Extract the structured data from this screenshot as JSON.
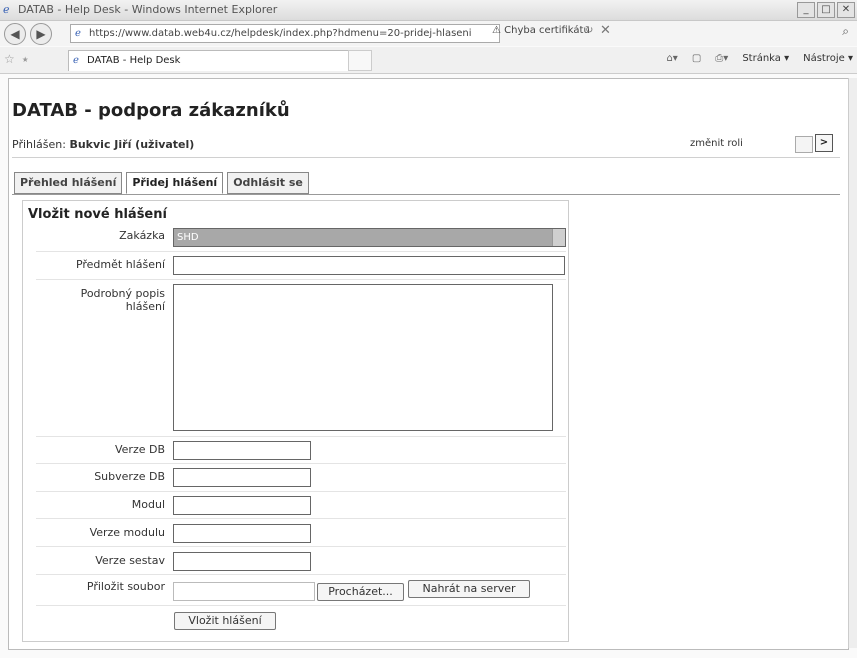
{
  "window": {
    "title": "DATAB - Help Desk - Windows Internet Explorer",
    "address": "https://www.datab.web4u.cz/helpdesk/index.php?hdmenu=20-pridej-hlaseni",
    "cert_error": "Chyba certifikátu",
    "tab_title": "DATAB - Help Desk",
    "cmd_page": "Stránka",
    "cmd_tools": "Nástroje"
  },
  "app": {
    "title": "DATAB - podpora zákazníků",
    "logged_label": "Přihlášen:",
    "logged_user": "Bukvic Jiří (uživatel)",
    "change_role": "změnit roli"
  },
  "tabs": [
    "Přehled hlášení",
    "Přidej hlášení",
    "Odhlásit se"
  ],
  "form": {
    "title": "Vložit nové hlášení",
    "labels": {
      "zakazka": "Zakázka",
      "predmet": "Předmět hlášení",
      "popis": "Podrobný popis hlášení",
      "verze_db": "Verze DB",
      "subverze_db": "Subverze DB",
      "modul": "Modul",
      "verze_modulu": "Verze modulu",
      "verze_sestav": "Verze sestav",
      "prilozit": "Přiložit soubor"
    },
    "zakazka_value": "SHD",
    "browse_label": "Procházet...",
    "upload_label": "Nahrát na server",
    "submit_label": "Vložit hlášení"
  }
}
